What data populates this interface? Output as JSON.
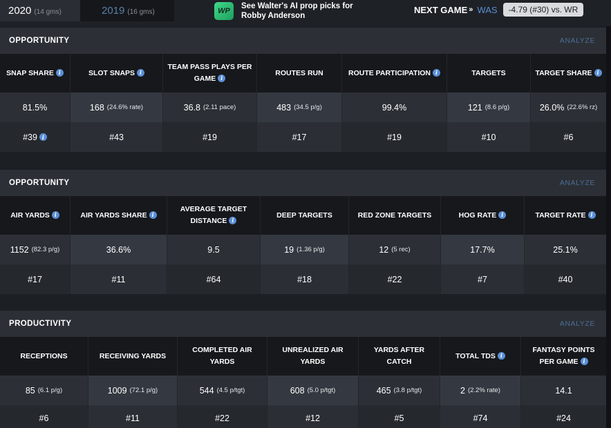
{
  "seasons": [
    {
      "year": "2020",
      "games": "(14 gms)",
      "active": true
    },
    {
      "year": "2019",
      "games": "(16 gms)",
      "active": false
    }
  ],
  "promo": {
    "logo": "WP",
    "text": "See Walter's AI prop picks for Robby Anderson"
  },
  "next_game": {
    "label": "NEXT GAME",
    "arrow": "»",
    "team": "WAS",
    "badge": "-4.79 (#30) vs. WR"
  },
  "analyze_label": "ANALYZE",
  "sections": [
    {
      "title": "OPPORTUNITY",
      "columns": [
        {
          "label": "SNAP SHARE",
          "info": true,
          "value": "81.5%",
          "sub": "",
          "rank": "#39",
          "rank_info": true
        },
        {
          "label": "SLOT SNAPS",
          "info": true,
          "value": "168",
          "sub": "(24.6% rate)",
          "rank": "#43",
          "rank_info": false
        },
        {
          "label": "TEAM PASS PLAYS PER GAME",
          "info": true,
          "value": "36.8",
          "sub": "(2.11 pace)",
          "rank": "#19",
          "rank_info": false
        },
        {
          "label": "ROUTES RUN",
          "info": false,
          "value": "483",
          "sub": "(34.5 p/g)",
          "rank": "#17",
          "rank_info": false
        },
        {
          "label": "ROUTE PARTICIPATION",
          "info": true,
          "value": "99.4%",
          "sub": "",
          "rank": "#19",
          "rank_info": false
        },
        {
          "label": "TARGETS",
          "info": false,
          "value": "121",
          "sub": "(8.6 p/g)",
          "rank": "#10",
          "rank_info": false
        },
        {
          "label": "TARGET SHARE",
          "info": true,
          "value": "26.0%",
          "sub": "(22.6% rz)",
          "rank": "#6",
          "rank_info": false
        }
      ]
    },
    {
      "title": "OPPORTUNITY",
      "columns": [
        {
          "label": "AIR YARDS",
          "info": true,
          "value": "1152",
          "sub": "(82.3 p/g)",
          "rank": "#17",
          "rank_info": false
        },
        {
          "label": "AIR YARDS SHARE",
          "info": true,
          "value": "36.6%",
          "sub": "",
          "rank": "#11",
          "rank_info": false
        },
        {
          "label": "AVERAGE TARGET DISTANCE",
          "info": true,
          "value": "9.5",
          "sub": "",
          "rank": "#64",
          "rank_info": false
        },
        {
          "label": "DEEP TARGETS",
          "info": false,
          "value": "19",
          "sub": "(1.36 p/g)",
          "rank": "#18",
          "rank_info": false
        },
        {
          "label": "RED ZONE TARGETS",
          "info": false,
          "value": "12",
          "sub": "(5 rec)",
          "rank": "#22",
          "rank_info": false
        },
        {
          "label": "HOG RATE",
          "info": true,
          "value": "17.7%",
          "sub": "",
          "rank": "#7",
          "rank_info": false
        },
        {
          "label": "TARGET RATE",
          "info": true,
          "value": "25.1%",
          "sub": "",
          "rank": "#40",
          "rank_info": false
        }
      ]
    },
    {
      "title": "PRODUCTIVITY",
      "columns": [
        {
          "label": "RECEPTIONS",
          "info": false,
          "value": "85",
          "sub": "(6.1 p/g)",
          "rank": "#6",
          "rank_info": false
        },
        {
          "label": "RECEIVING YARDS",
          "info": false,
          "value": "1009",
          "sub": "(72.1 p/g)",
          "rank": "#11",
          "rank_info": false
        },
        {
          "label": "COMPLETED AIR YARDS",
          "info": false,
          "value": "544",
          "sub": "(4.5 p/tgt)",
          "rank": "#22",
          "rank_info": false
        },
        {
          "label": "UNREALIZED AIR YARDS",
          "info": false,
          "value": "608",
          "sub": "(5.0 p/tgt)",
          "rank": "#12",
          "rank_info": false
        },
        {
          "label": "YARDS AFTER CATCH",
          "info": false,
          "value": "465",
          "sub": "(3.8 p/tgt)",
          "rank": "#5",
          "rank_info": false
        },
        {
          "label": "TOTAL TDS",
          "info": true,
          "value": "2",
          "sub": "(2.2% rate)",
          "rank": "#74",
          "rank_info": false
        },
        {
          "label": "FANTASY POINTS PER GAME",
          "info": true,
          "value": "14.1",
          "sub": "",
          "rank": "#24",
          "rank_info": false
        }
      ]
    }
  ]
}
